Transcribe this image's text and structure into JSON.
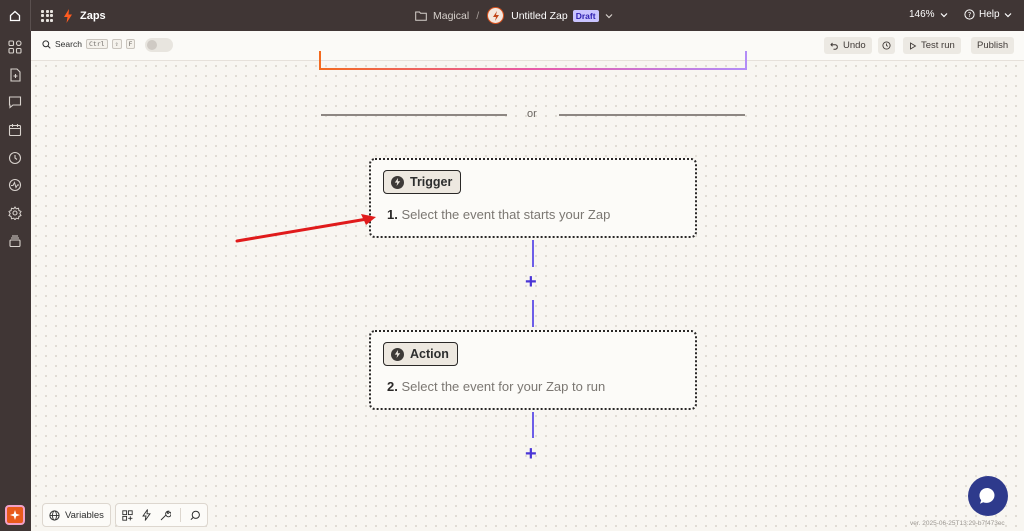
{
  "header": {
    "app_name": "Zaps",
    "folder": "Magical",
    "separator": "/",
    "zap_title": "Untitled Zap",
    "status": "Draft",
    "zoom": "146%",
    "help": "Help"
  },
  "toolbar": {
    "search_label": "Search",
    "shortcut_keys": [
      "Ctrl",
      "⇧",
      "F"
    ],
    "undo_label": "Undo",
    "test_run_label": "Test run",
    "publish_label": "Publish"
  },
  "canvas": {
    "or_label": "or",
    "trigger": {
      "badge": "Trigger",
      "number": "1.",
      "text": "Select the event that starts your Zap"
    },
    "action": {
      "badge": "Action",
      "number": "2.",
      "text": "Select the event for your Zap to run"
    },
    "add_step_symbol": "+"
  },
  "bottom_toolbar": {
    "variables_label": "Variables"
  },
  "version": "ver. 2025-06-25T13:29-b7f473ec",
  "colors": {
    "topbar": "#403635",
    "accent_orange": "#e85a1b",
    "connector": "#6d5ee8",
    "plus": "#4a36d6",
    "draft_badge": "#c9c4ff",
    "annotation_arrow": "#e01b1b",
    "chat_button": "#2e3a8c"
  }
}
